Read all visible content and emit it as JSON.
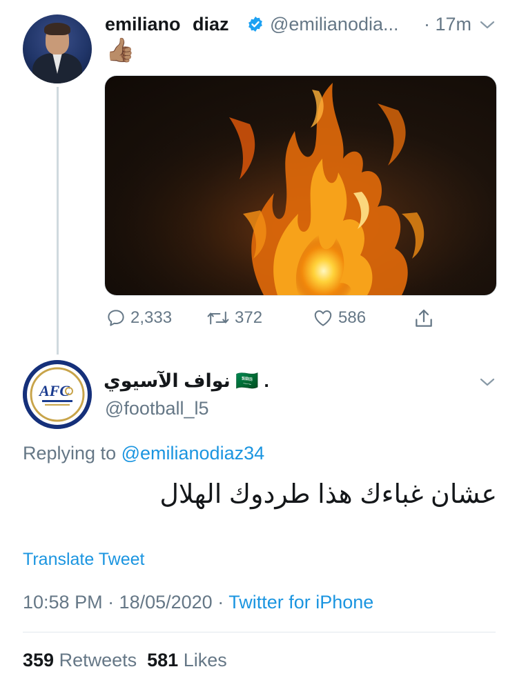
{
  "tweet": {
    "author_name": "emiliano  diaz",
    "author_handle": "@emilianodia...",
    "time_ago": "· 17m",
    "text_emoji": "👍🏽",
    "actions": {
      "replies": "2,333",
      "retweets": "372",
      "likes": "586"
    }
  },
  "reply": {
    "author_name": "نواف الآسيوي 🇸🇦 .",
    "author_handle": "@football_l5",
    "replying_to_prefix": "Replying to ",
    "replying_to_handle": "@emilianodiaz34",
    "text": "عشان غباءك هذا طردوك الهلال",
    "translate_label": "Translate Tweet",
    "timestamp": "10:58 PM · 18/05/2020 · ",
    "source": "Twitter for iPhone",
    "retweet_count": "359",
    "retweet_label": " Retweets",
    "like_count": "581",
    "like_label": " Likes",
    "avatar_logo_text": "AFC"
  },
  "colors": {
    "link": "#1b95e0",
    "muted": "#657786",
    "verified": "#1da1f2"
  },
  "icons": [
    "verified-badge-icon",
    "chevron-down-icon",
    "reply-icon",
    "retweet-icon",
    "like-icon",
    "share-icon"
  ]
}
